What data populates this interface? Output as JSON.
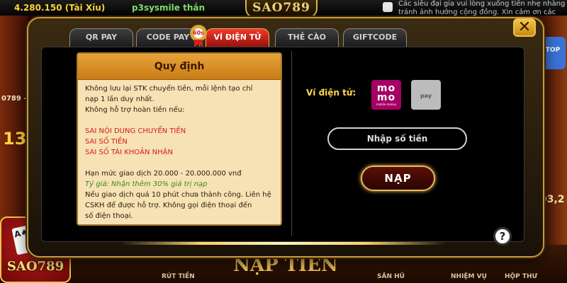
{
  "background": {
    "topbar": {
      "balance": "4.280.150 (Tài Xỉu)",
      "username": "p3sysmile thắn",
      "notice": "Các siêu đại gia vui lòng xuống tiền nhẹ nhàng tránh ảnh hưởng cộng đồng. Xin cảm ơn các chơi"
    },
    "logo_text": "SAO789",
    "left_big_number": "13",
    "left_small_text": "0789 -",
    "right_badge": "TOP",
    "right_number": "03,2",
    "badge_brand": "SAO789",
    "bottom_title": "NẠP TIỀN",
    "bottom_nav": [
      "RÚT TIỀN",
      "SĂN HŨ",
      "NHIỆM VỤ",
      "HỘP THƯ"
    ]
  },
  "tabs": [
    {
      "label": "QR PAY"
    },
    {
      "label": "CODE PAY"
    },
    {
      "label": "VÍ ĐIỆN TỬ",
      "active": true
    },
    {
      "label": "THẺ CÀO"
    },
    {
      "label": "GIFTCODE"
    }
  ],
  "tab_badge": "60s",
  "close_label": "✕",
  "rules": {
    "title": "Quy định",
    "lines": [
      "Không lưu lại STK chuyển tiền, mỗi lệnh tạo chỉ",
      "nạp 1 lần duy nhất.",
      "Không hỗ trợ hoàn tiền nếu:"
    ],
    "warnings": [
      "SAI NỘI DUNG CHUYỂN TIỀN",
      "SAI SỐ TIỀN",
      "SAI SỐ TÀI KHOẢN NHẬN"
    ],
    "limit": "Hạn mức giao dịch 20.000 - 20.000.000 vnđ",
    "rate": "Tỷ giá: Nhận thêm 30% giá trị nạp",
    "footer": [
      "Nếu giao dịch quá 10 phút chưa thành công. Liên hệ",
      "CSKH để được hỗ trợ. Không gọi điện thoại đến",
      "số điện thoại."
    ]
  },
  "wallet": {
    "label": "Ví điện tử:",
    "momo_text": "mo mo",
    "momo_sub": "mobile money",
    "vpay_text": "pay"
  },
  "amount_input": {
    "placeholder": "Nhập số tiền",
    "value": ""
  },
  "submit_label": "NẠP",
  "help_label": "?"
}
